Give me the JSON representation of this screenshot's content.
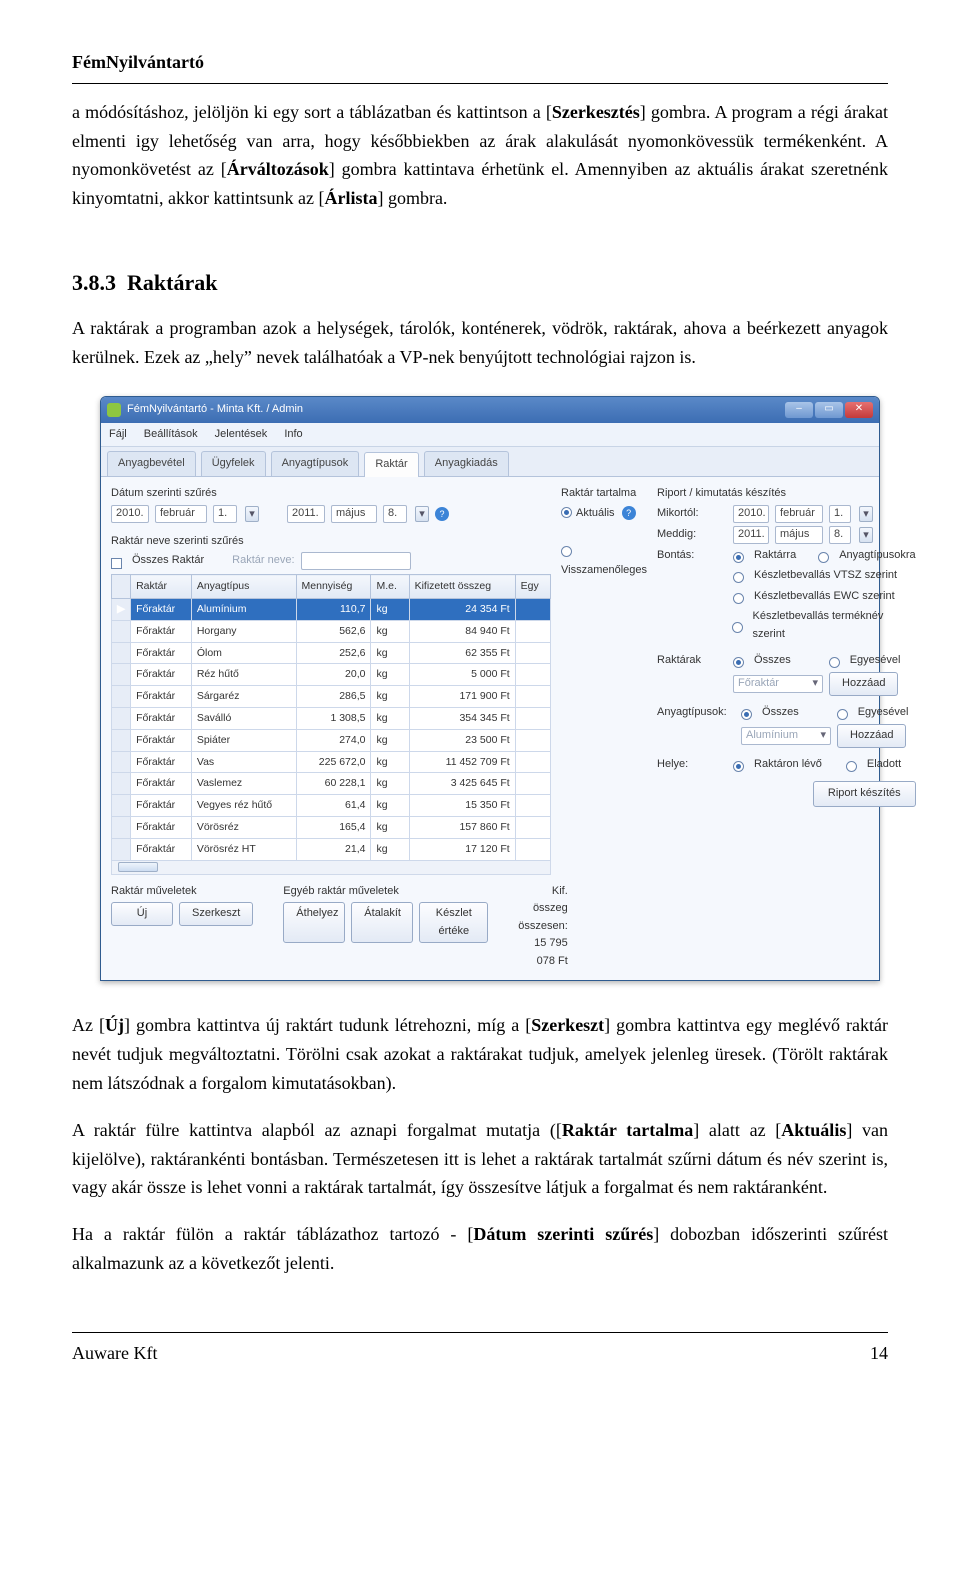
{
  "doc": {
    "header": "FémNyilvántartó",
    "para1_a": "a módósításhoz, jelöljön ki egy sort a táblázatban és kattintson a [",
    "para1_b": "Szerkesztés",
    "para1_c": "] gombra. A program a régi árakat elmenti igy lehetőség van arra, hogy későbbiekben az árak alakulását nyomonkövessük termékenként. A nyomonkövetést az [",
    "para1_d": "Árváltozások",
    "para1_e": "] gombra kattintava érhetünk el. Amennyiben az aktuális árakat szeretnénk kinyomtatni, akkor kattintsunk az [",
    "para1_f": "Árlista",
    "para1_g": "] gombra.",
    "sectionNo": "3.8.3",
    "sectionTitle": "Raktárak",
    "para2": "A raktárak a programban azok a helységek, tárolók, konténerek, vödrök, raktárak, ahova a beérkezett anyagok kerülnek. Ezek az „hely” nevek találhatóak a VP-nek benyújtott technológiai rajzon is.",
    "para3_a": "Az [",
    "para3_b": "Új",
    "para3_c": "] gombra kattintva új raktárt tudunk létrehozni, míg a [",
    "para3_d": "Szerkeszt",
    "para3_e": "] gombra kattintva egy meglévő raktár nevét tudjuk megváltoztatni. Törölni csak azokat a raktárakat tudjuk, amelyek jelenleg üresek. (Törölt raktárak nem látszódnak a forgalom kimutatásokban).",
    "para4_a": "A raktár fülre kattintva alapból az aznapi forgalmat mutatja ([",
    "para4_b": "Raktár tartalma",
    "para4_c": "] alatt az [",
    "para4_d": "Aktuális",
    "para4_e": "] van kijelölve), raktárankénti bontásban. Természetesen itt is lehet a raktárak tartalmát szűrni dátum és név szerint is, vagy akár össze is lehet vonni a raktárak tartalmát, így összesítve látjuk a forgalmat és nem raktáranként.",
    "para5_a": "Ha a raktár fülön a raktár táblázathoz tartozó - [",
    "para5_b": "Dátum szerinti szűrés",
    "para5_c": "] dobozban időszerinti szűrést alkalmazunk az a következőt jelenti.",
    "footer_left": "Auware Kft",
    "footer_right": "14"
  },
  "win": {
    "title": "FémNyilvántartó - Minta Kft. / Admin",
    "menus": [
      "Fájl",
      "Beállítások",
      "Jelentések",
      "Info"
    ],
    "tabs": [
      "Anyagbevétel",
      "Ügyfelek",
      "Anyagtípusok",
      "Raktár",
      "Anyagkiadás"
    ],
    "activeTab": "Raktár",
    "dateFilterTitle": "Dátum szerinti szűrés",
    "from": {
      "year": "2010.",
      "month": "február",
      "day": "1."
    },
    "to": {
      "year": "2011.",
      "month": "május",
      "day": "8."
    },
    "raktarFilterTitle": "Raktár neve szerinti szűrés",
    "osszesRaktar": "Összes Raktár",
    "raktarNeveLbl": "Raktár neve:",
    "tartalmaTitle": "Raktár tartalma",
    "aktualis": "Aktuális",
    "visszamenoleges": "Visszamenőleges",
    "table": {
      "headers": [
        "Raktár",
        "Anyagtípus",
        "Mennyiség",
        "M.e.",
        "Kifizetett összeg",
        "Egy"
      ],
      "rows": [
        [
          "Főraktár",
          "Alumínium",
          "110,7",
          "kg",
          "24 354 Ft",
          ""
        ],
        [
          "Főraktár",
          "Horgany",
          "562,6",
          "kg",
          "84 940 Ft",
          ""
        ],
        [
          "Főraktár",
          "Ólom",
          "252,6",
          "kg",
          "62 355 Ft",
          ""
        ],
        [
          "Főraktár",
          "Réz hűtő",
          "20,0",
          "kg",
          "5 000 Ft",
          ""
        ],
        [
          "Főraktár",
          "Sárgaréz",
          "286,5",
          "kg",
          "171 900 Ft",
          ""
        ],
        [
          "Főraktár",
          "Saválló",
          "1 308,5",
          "kg",
          "354 345 Ft",
          ""
        ],
        [
          "Főraktár",
          "Spiáter",
          "274,0",
          "kg",
          "23 500 Ft",
          ""
        ],
        [
          "Főraktár",
          "Vas",
          "225 672,0",
          "kg",
          "11 452 709 Ft",
          ""
        ],
        [
          "Főraktár",
          "Vaslemez",
          "60 228,1",
          "kg",
          "3 425 645 Ft",
          ""
        ],
        [
          "Főraktár",
          "Vegyes réz hűtő",
          "61,4",
          "kg",
          "15 350 Ft",
          ""
        ],
        [
          "Főraktár",
          "Vörösréz",
          "165,4",
          "kg",
          "157 860 Ft",
          ""
        ],
        [
          "Főraktár",
          "Vörösréz HT",
          "21,4",
          "kg",
          "17 120 Ft",
          ""
        ]
      ],
      "selectedRow": 0
    },
    "bottom": {
      "grp1": "Raktár műveletek",
      "btnNew": "Új",
      "btnEdit": "Szerkeszt",
      "grp2": "Egyéb raktár műveletek",
      "btnAthelyez": "Áthelyez",
      "btnAtalakit": "Átalakít",
      "btnKeszlet": "Készlet értéke",
      "sumLbl": "Kif. összeg összesen:",
      "sumVal": "15 795 078 Ft"
    },
    "right": {
      "riportTitle": "Riport / kimutatás készítés",
      "mikortol": "Mikortól:",
      "from": {
        "year": "2010.",
        "month": "február",
        "day": "1."
      },
      "meddig": "Meddig:",
      "to": {
        "year": "2011.",
        "month": "május",
        "day": "8."
      },
      "bontas": "Bontás:",
      "bontasOpts": [
        "Raktárra",
        "Anyagtípusokra",
        "Készletbevallás VTSZ szerint",
        "Készletbevallás EWC szerint",
        "Készletbevallás terméknév szerint"
      ],
      "raktarak": "Raktárak",
      "osszes": "Összes",
      "egyesevel": "Egyesével",
      "foraktar": "Főraktár",
      "hozzaad": "Hozzáad",
      "anyagtipusok": "Anyagtípusok:",
      "aluminium": "Alumínium",
      "helye": "Helye:",
      "raktaronLevo": "Raktáron lévő",
      "eladott": "Eladott",
      "btnRiport": "Riport készítés"
    }
  }
}
